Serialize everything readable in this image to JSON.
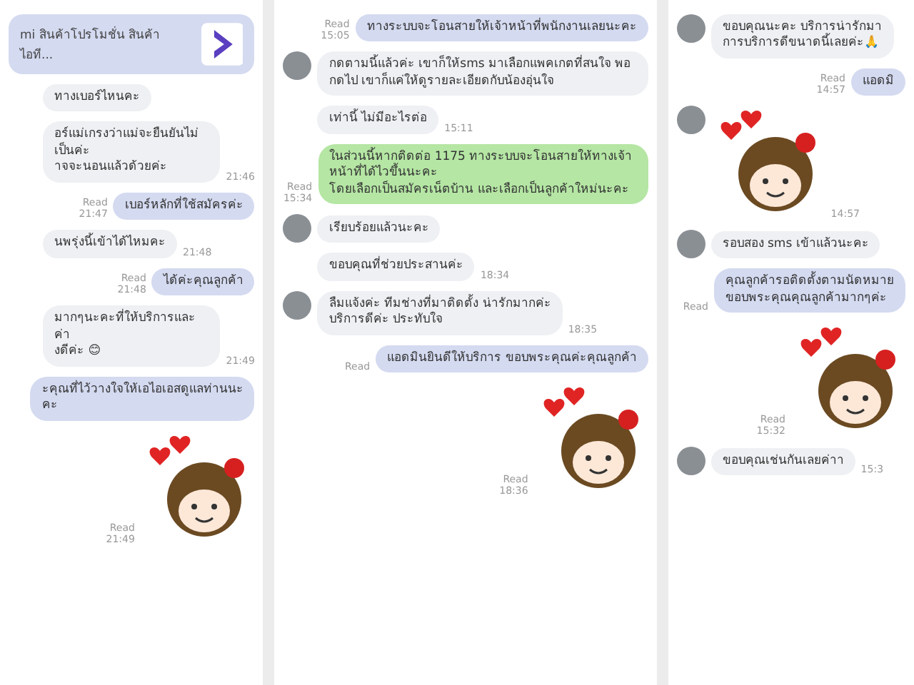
{
  "panels": [
    {
      "messages": [
        {
          "kind": "link-out",
          "avatar": false,
          "text": "mi สินค้าโปรโมชั่น สินค้าไอที...",
          "color": "#d4daf0"
        },
        {
          "kind": "text-in",
          "avatar": false,
          "text": "ทางเบอร์ไหนคะ"
        },
        {
          "kind": "text-in",
          "avatar": false,
          "text": "อร์แม่เกรงว่าแม่จะยืนยันไม่เป็นค่ะ\nาจจะนอนแล้วด้วยค่ะ",
          "time": "21:46"
        },
        {
          "kind": "text-out",
          "avatar": false,
          "text": "เบอร์หลักที่ใช้สมัครค่ะ",
          "read": "Read",
          "time": "21:47",
          "color": "#d4daf0"
        },
        {
          "kind": "text-in",
          "avatar": false,
          "text": "นพรุ่งนี้เข้าได้ไหมคะ",
          "time": "21:48"
        },
        {
          "kind": "text-out",
          "avatar": false,
          "text": "ได้ค่ะคุณลูกค้า",
          "read": "Read",
          "time": "21:48",
          "color": "#d4daf0"
        },
        {
          "kind": "text-in",
          "avatar": false,
          "text": "มากๆนะคะที่ให้บริการและค่า\nงดีค่ะ 😊",
          "time": "21:49"
        },
        {
          "kind": "text-out",
          "avatar": false,
          "text": "ะคุณที่ไว้วางใจให้เอไอเอสดูแลท่านนะคะ",
          "color": "#d4daf0"
        },
        {
          "kind": "sticker-out",
          "avatar": false,
          "read": "Read",
          "time": "21:49"
        }
      ]
    },
    {
      "messages": [
        {
          "kind": "text-out",
          "avatar": false,
          "text": "ทางระบบจะโอนสายให้เจ้าหน้าที่พนักงานเลยนะคะ",
          "read": "Read",
          "time": "15:05",
          "color": "#d4daf0"
        },
        {
          "kind": "text-in",
          "avatar": true,
          "text": "กดตามนี้แล้วค่ะ เขาก็ให้sms มาเลือกแพคเกตที่สนใจ พอกดไป เขาก็แค่ให้ดูรายละเอียดกับน้องอุ่นใจ"
        },
        {
          "kind": "text-in",
          "avatar": false,
          "text": "เท่านี้ ไม่มีอะไรต่อ",
          "time": "15:11"
        },
        {
          "kind": "text-out",
          "avatar": false,
          "text": "ในส่วนนี้หากติดต่อ 1175 ทางระบบจะโอนสายให้ทางเจ้าหน้าที่ได้ไวขึ้นนะคะ\nโดยเลือกเป็นสมัครเน็ตบ้าน และเลือกเป็นลูกค้าใหม่นะคะ",
          "read": "Read",
          "time": "15:34",
          "color": "#b5e6a4"
        },
        {
          "kind": "text-in",
          "avatar": true,
          "text": "เรียบร้อยแล้วนะคะ"
        },
        {
          "kind": "text-in",
          "avatar": false,
          "text": "ขอบคุณที่ช่วยประสานค่ะ",
          "time": "18:34"
        },
        {
          "kind": "text-in",
          "avatar": true,
          "text": "ลืมแจ้งค่ะ ทีมช่างที่มาติดตั้ง น่ารักมากค่ะ\nบริการดีค่ะ ประทับใจ",
          "time": "18:35"
        },
        {
          "kind": "text-out",
          "avatar": false,
          "text": "แอดมินยินดีให้บริการ ขอบพระคุณค่ะคุณลูกค้า",
          "read": "Read",
          "color": "#d4daf0"
        },
        {
          "kind": "sticker-out",
          "avatar": false,
          "read": "Read",
          "time": "18:36"
        }
      ]
    },
    {
      "messages": [
        {
          "kind": "text-in",
          "avatar": true,
          "text": "ขอบคุณนะคะ บริการน่ารักมา\nการบริการดีขนาดนี้เลยค่ะ🙏"
        },
        {
          "kind": "text-out",
          "avatar": false,
          "text": "แอดมิ",
          "read": "Read",
          "time": "14:57",
          "color": "#d4daf0"
        },
        {
          "kind": "sticker-in",
          "avatar": true,
          "time": "14:57"
        },
        {
          "kind": "text-in",
          "avatar": true,
          "text": "รอบสอง sms เข้าแล้วนะคะ"
        },
        {
          "kind": "text-out",
          "avatar": false,
          "text": "คุณลูกค้ารอติดตั้งตามนัดหมาย\nขอบพระคุณคุณลูกค้ามากๆค่ะ",
          "read": "Read",
          "color": "#d4daf0"
        },
        {
          "kind": "sticker-out",
          "avatar": false,
          "read": "Read",
          "time": "15:32"
        },
        {
          "kind": "text-in",
          "avatar": true,
          "text": "ขอบคุณเช่นกันเลยค่าา",
          "time": "15:3"
        }
      ]
    }
  ]
}
